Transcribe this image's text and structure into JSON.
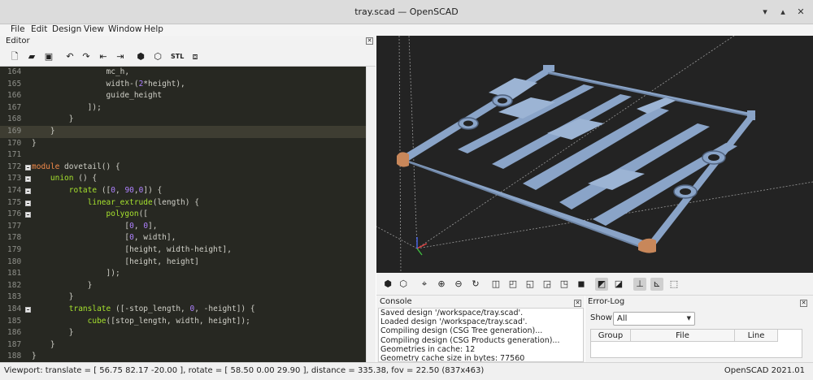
{
  "window": {
    "title": "tray.scad — OpenSCAD",
    "controls": {
      "minimize": "▾",
      "maximize": "▴",
      "close": "✕"
    }
  },
  "menu": [
    "File",
    "Edit",
    "Design",
    "View",
    "Window",
    "Help"
  ],
  "editor": {
    "title": "Editor",
    "toolbar": [
      "new-icon",
      "open-icon",
      "save-icon",
      "undo-icon",
      "redo-icon",
      "unindent-icon",
      "indent-icon",
      "preview-icon",
      "render-icon",
      "export-stl-icon",
      "send-to-3d-print-icon"
    ],
    "toolbar_text": {
      "stl": "STL"
    },
    "current_line": 169,
    "lines": [
      {
        "n": "164",
        "fold": false,
        "indent": "                ",
        "parts": [
          [
            "p",
            "mc_h,"
          ]
        ]
      },
      {
        "n": "165",
        "fold": false,
        "indent": "                ",
        "parts": [
          [
            "p",
            "width-("
          ],
          [
            "n",
            "2"
          ],
          [
            "p",
            "*height),"
          ]
        ]
      },
      {
        "n": "166",
        "fold": false,
        "indent": "                ",
        "parts": [
          [
            "p",
            "guide_height"
          ]
        ]
      },
      {
        "n": "167",
        "fold": false,
        "indent": "            ",
        "parts": [
          [
            "p",
            "]);"
          ]
        ]
      },
      {
        "n": "168",
        "fold": false,
        "indent": "        ",
        "parts": [
          [
            "p",
            "}"
          ]
        ]
      },
      {
        "n": "169",
        "fold": false,
        "indent": "    ",
        "parts": [
          [
            "p",
            "}"
          ]
        ]
      },
      {
        "n": "170",
        "fold": false,
        "indent": "",
        "parts": [
          [
            "p",
            "}"
          ]
        ]
      },
      {
        "n": "171",
        "fold": false,
        "indent": "",
        "parts": []
      },
      {
        "n": "172",
        "fold": true,
        "indent": "",
        "parts": [
          [
            "k",
            "module"
          ],
          [
            "p",
            " dovetail() {"
          ]
        ]
      },
      {
        "n": "173",
        "fold": true,
        "indent": "    ",
        "parts": [
          [
            "f",
            "union"
          ],
          [
            "p",
            " () {"
          ]
        ]
      },
      {
        "n": "174",
        "fold": true,
        "indent": "        ",
        "parts": [
          [
            "f",
            "rotate"
          ],
          [
            "p",
            " (["
          ],
          [
            "n",
            "0"
          ],
          [
            "p",
            ", "
          ],
          [
            "n",
            "90"
          ],
          [
            "p",
            ","
          ],
          [
            "n",
            "0"
          ],
          [
            "p",
            "]) {"
          ]
        ]
      },
      {
        "n": "175",
        "fold": true,
        "indent": "            ",
        "parts": [
          [
            "f",
            "linear_extrude"
          ],
          [
            "p",
            "(length) {"
          ]
        ]
      },
      {
        "n": "176",
        "fold": true,
        "indent": "                ",
        "parts": [
          [
            "f",
            "polygon"
          ],
          [
            "p",
            "(["
          ]
        ]
      },
      {
        "n": "177",
        "fold": false,
        "indent": "                    ",
        "parts": [
          [
            "p",
            "["
          ],
          [
            "n",
            "0"
          ],
          [
            "p",
            ", "
          ],
          [
            "n",
            "0"
          ],
          [
            "p",
            "],"
          ]
        ]
      },
      {
        "n": "178",
        "fold": false,
        "indent": "                    ",
        "parts": [
          [
            "p",
            "["
          ],
          [
            "n",
            "0"
          ],
          [
            "p",
            ", width],"
          ]
        ]
      },
      {
        "n": "179",
        "fold": false,
        "indent": "                    ",
        "parts": [
          [
            "p",
            "[height, width-height],"
          ]
        ]
      },
      {
        "n": "180",
        "fold": false,
        "indent": "                    ",
        "parts": [
          [
            "p",
            "[height, height]"
          ]
        ]
      },
      {
        "n": "181",
        "fold": false,
        "indent": "                ",
        "parts": [
          [
            "p",
            "]);"
          ]
        ]
      },
      {
        "n": "182",
        "fold": false,
        "indent": "            ",
        "parts": [
          [
            "p",
            "}"
          ]
        ]
      },
      {
        "n": "183",
        "fold": false,
        "indent": "        ",
        "parts": [
          [
            "p",
            "}"
          ]
        ]
      },
      {
        "n": "184",
        "fold": true,
        "indent": "        ",
        "parts": [
          [
            "f",
            "translate"
          ],
          [
            "p",
            " ([-stop_length, "
          ],
          [
            "n",
            "0"
          ],
          [
            "p",
            ", -height]) {"
          ]
        ]
      },
      {
        "n": "185",
        "fold": false,
        "indent": "            ",
        "parts": [
          [
            "f",
            "cube"
          ],
          [
            "p",
            "([stop_length, width, height]);"
          ]
        ]
      },
      {
        "n": "186",
        "fold": false,
        "indent": "        ",
        "parts": [
          [
            "p",
            "}"
          ]
        ]
      },
      {
        "n": "187",
        "fold": false,
        "indent": "    ",
        "parts": [
          [
            "p",
            "}"
          ]
        ]
      },
      {
        "n": "188",
        "fold": false,
        "indent": "",
        "parts": [
          [
            "p",
            "}"
          ]
        ]
      }
    ]
  },
  "viewer": {
    "background": "#232323",
    "model_color": "#8aa4c8",
    "highlight_color": "#c8875a",
    "toolbar": [
      "preview-icon",
      "render-icon",
      "view-all-icon",
      "zoom-in-icon",
      "zoom-out-icon",
      "reset-view-icon",
      "view-right-icon",
      "view-top-icon",
      "view-bottom-icon",
      "view-left-icon",
      "view-front-icon",
      "view-back-icon",
      "perspective-icon",
      "orthogonal-icon",
      "show-axes-icon",
      "show-scale-markers-icon",
      "show-edges-icon"
    ]
  },
  "console": {
    "title": "Console",
    "lines": [
      "Saved design '/workspace/tray.scad'.",
      "Loaded design '/workspace/tray.scad'.",
      "Compiling design (CSG Tree generation)...",
      "Compiling design (CSG Products generation)...",
      "Geometries in cache: 12",
      "Geometry cache size in bytes: 77560"
    ]
  },
  "error_log": {
    "title": "Error-Log",
    "show_label": "Show",
    "show_value": "All",
    "columns": [
      "Group",
      "File",
      "Line"
    ]
  },
  "status": {
    "viewport": "Viewport: translate = [ 56.75 82.17 -20.00 ], rotate = [ 58.50 0.00 29.90 ], distance = 335.38, fov = 22.50 (837x463)",
    "version": "OpenSCAD 2021.01"
  }
}
